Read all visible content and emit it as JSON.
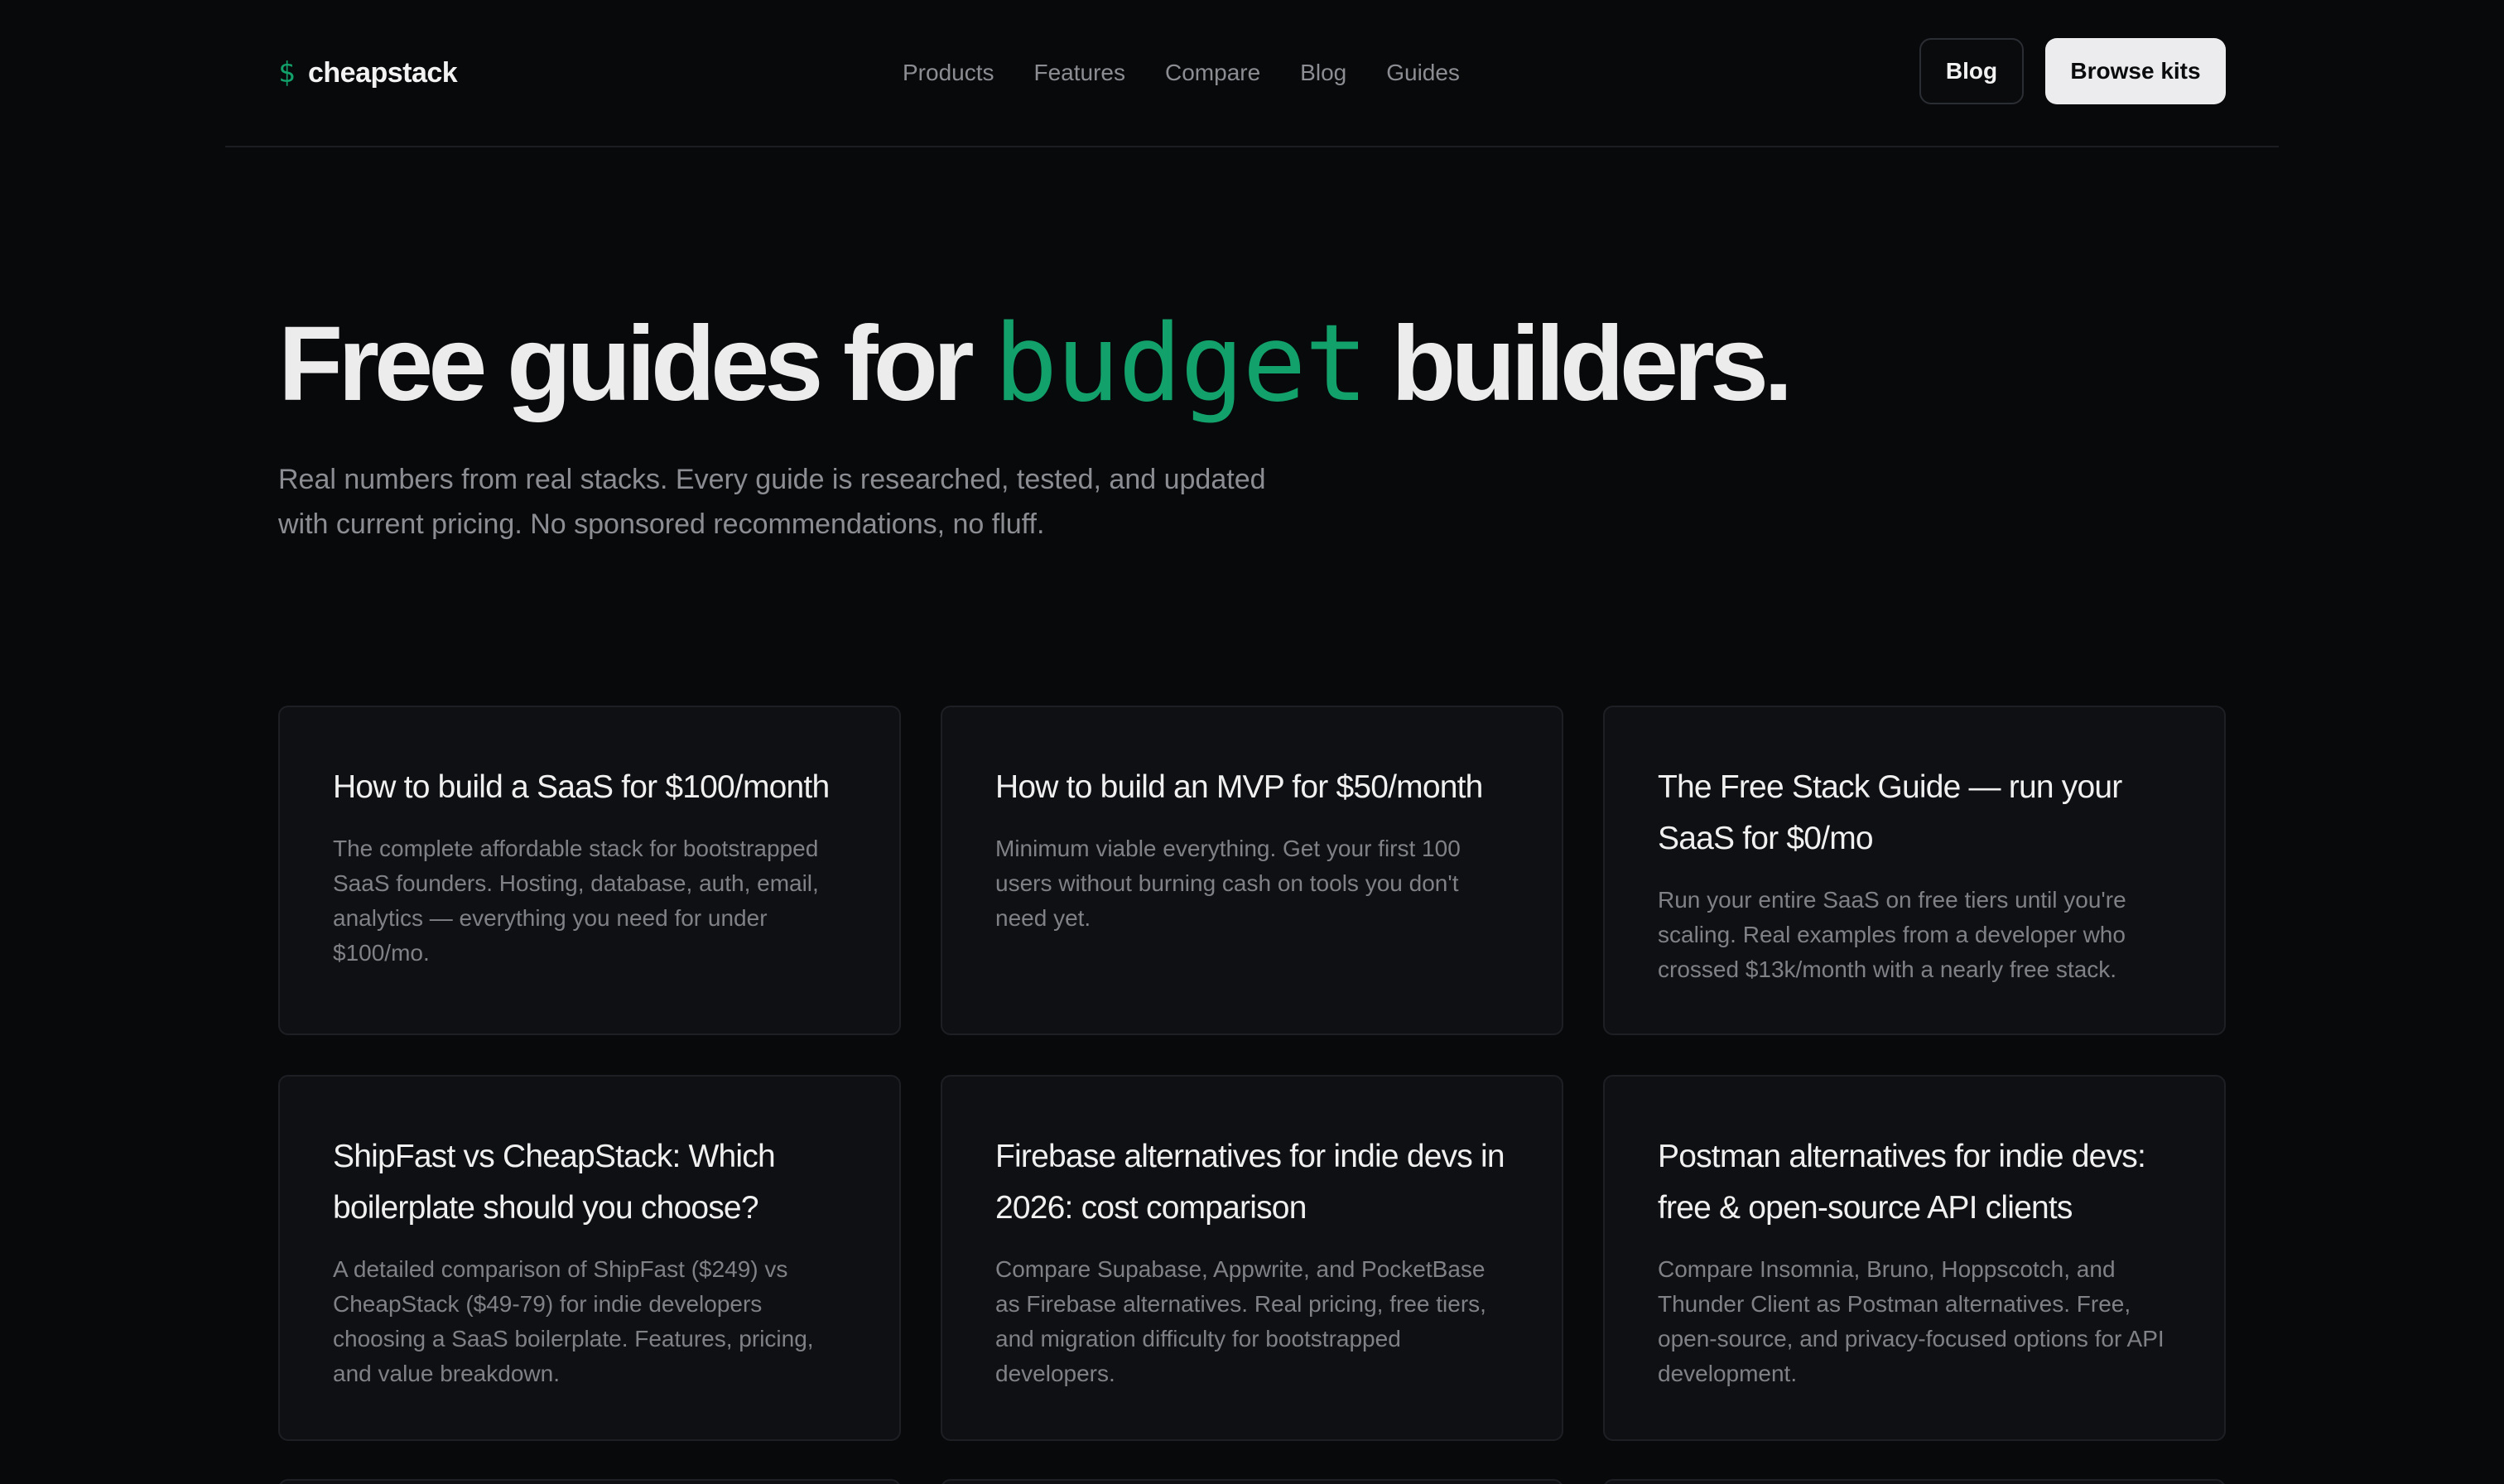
{
  "brand": {
    "icon": "dollar-icon",
    "icon_glyph": "$",
    "name": "cheapstack"
  },
  "nav": [
    "Products",
    "Features",
    "Compare",
    "Blog",
    "Guides"
  ],
  "header_actions": {
    "blog_label": "Blog",
    "browse_label": "Browse kits"
  },
  "hero": {
    "title_before": "Free guides for ",
    "title_highlight": "budget",
    "title_after": " builders.",
    "subtitle": "Real numbers from real stacks. Every guide is researched, tested, and updated with current pricing. No sponsored recommendations, no fluff."
  },
  "guides": [
    {
      "title": "How to build a SaaS for $100/month",
      "description": "The complete affordable stack for bootstrapped SaaS founders. Hosting, database, auth, email, analytics — everything you need for under $100/mo."
    },
    {
      "title": "How to build an MVP for $50/month",
      "description": "Minimum viable everything. Get your first 100 users without burning cash on tools you don't need yet."
    },
    {
      "title": "The Free Stack Guide — run your SaaS for $0/mo",
      "description": "Run your entire SaaS on free tiers until you're scaling. Real examples from a developer who crossed $13k/month with a nearly free stack."
    },
    {
      "title": "ShipFast vs CheapStack: Which boilerplate should you choose?",
      "description": "A detailed comparison of ShipFast ($249) vs CheapStack ($49-79) for indie developers choosing a SaaS boilerplate. Features, pricing, and value breakdown."
    },
    {
      "title": "Firebase alternatives for indie devs in 2026: cost comparison",
      "description": "Compare Supabase, Appwrite, and PocketBase as Firebase alternatives. Real pricing, free tiers, and migration difficulty for bootstrapped developers."
    },
    {
      "title": "Postman alternatives for indie devs: free & open-source API clients",
      "description": "Compare Insomnia, Bruno, Hoppscotch, and Thunder Client as Postman alternatives. Free, open-source, and privacy-focused options for API development."
    }
  ],
  "colors": {
    "background": "#08090b",
    "accent": "#12a16a",
    "card": "#0f1013",
    "muted_text": "#8b8d93"
  }
}
